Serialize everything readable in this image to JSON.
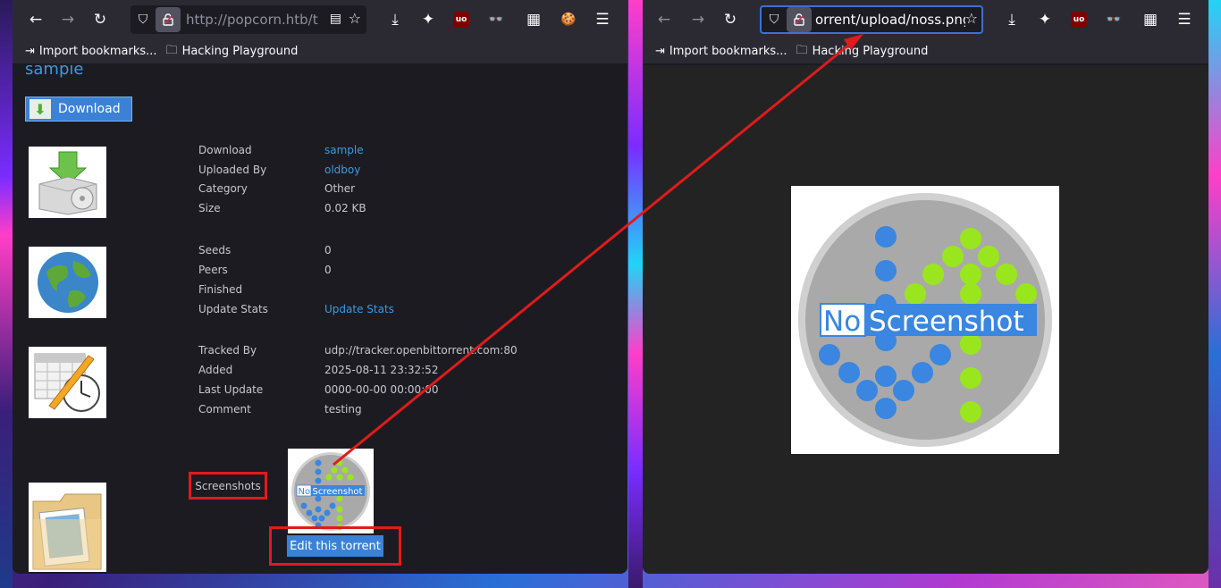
{
  "left_window": {
    "url": "http://popcorn.htb/t",
    "bookmarks": [
      {
        "label": "Import bookmarks...",
        "icon": "import-icon"
      },
      {
        "label": "Hacking Playground",
        "icon": "folder-icon"
      }
    ],
    "page": {
      "title": "sample",
      "download_button": "Download",
      "rows": [
        {
          "label": "Download",
          "value": "sample",
          "link": true
        },
        {
          "label": "Uploaded By",
          "value": "oldboy",
          "link": true
        },
        {
          "label": "Category",
          "value": "Other",
          "link": false
        },
        {
          "label": "Size",
          "value": "0.02 KB",
          "link": false
        },
        {
          "label": "Seeds",
          "value": "0",
          "link": false
        },
        {
          "label": "Peers",
          "value": "0",
          "link": false
        },
        {
          "label": "Finished",
          "value": "",
          "link": false
        },
        {
          "label": "Update Stats",
          "value": "Update Stats",
          "link": true
        },
        {
          "label": "Tracked By",
          "value": "udp://tracker.openbittorrent.com:80",
          "link": false
        },
        {
          "label": "Added",
          "value": "2025-08-11 23:32:52",
          "link": false
        },
        {
          "label": "Last Update",
          "value": "0000-00-00 00:00:00",
          "link": false
        },
        {
          "label": "Comment",
          "value": "testing",
          "link": false
        }
      ],
      "screenshots_label": "Screenshots",
      "edit_button": "Edit this torrent",
      "no_screenshot_text": {
        "no": "No",
        "screenshot": "Screenshot"
      }
    }
  },
  "right_window": {
    "url": "orrent/upload/noss.png",
    "bookmarks": [
      {
        "label": "Import bookmarks...",
        "icon": "import-icon"
      },
      {
        "label": "Hacking Playground",
        "icon": "folder-icon"
      }
    ],
    "image_text": {
      "no": "No",
      "screenshot": "Screenshot"
    }
  },
  "colors": {
    "annotation_red": "#e01b1b",
    "link_blue": "#3b9bde",
    "button_blue": "#3b82d6",
    "dot_blue": "#3a86e0",
    "dot_green": "#9ae61e",
    "circle_gray": "#a9a9a9"
  }
}
